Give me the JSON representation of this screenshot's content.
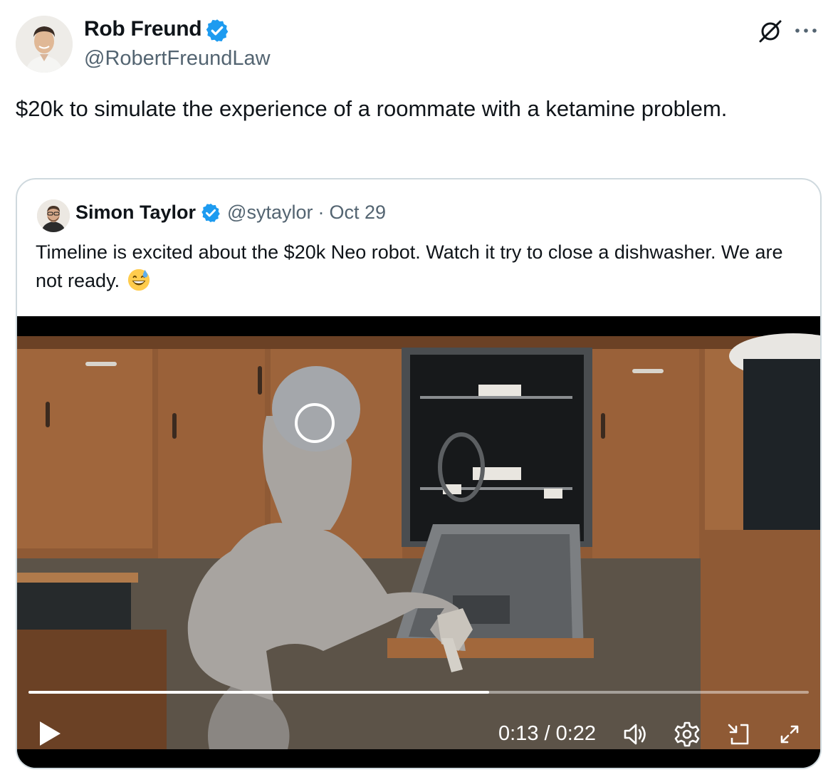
{
  "author": {
    "name": "Rob Freund",
    "handle": "@RobertFreundLaw",
    "verified": true,
    "avatar": "avatar-photo"
  },
  "tweet_text": "$20k to simulate the experience of a roommate with a ketamine problem.",
  "actions": {
    "grok_icon": "grok-icon",
    "more_icon": "more-icon"
  },
  "quoted_tweet": {
    "name": "Simon Taylor",
    "handle": "@sytaylor",
    "separator": "·",
    "date": "Oct 29",
    "verified": true,
    "text": "Timeline is excited about the $20k Neo robot. Watch it try to close a dishwasher. We are not ready.",
    "emoji": "grinning-face-with-sweat-emoji"
  },
  "video": {
    "current_time": "0:13",
    "duration": "0:22",
    "time_display": "0:13 / 0:22",
    "progress": 0.59,
    "controls": [
      "play-icon",
      "volume-icon",
      "settings-icon",
      "pip-icon",
      "fullscreen-icon"
    ]
  },
  "colors": {
    "verified_blue": "#1d9bf0",
    "text": "#0f1419",
    "secondary_text": "#536471",
    "border": "#cfd9de",
    "video_background": "#000000"
  }
}
